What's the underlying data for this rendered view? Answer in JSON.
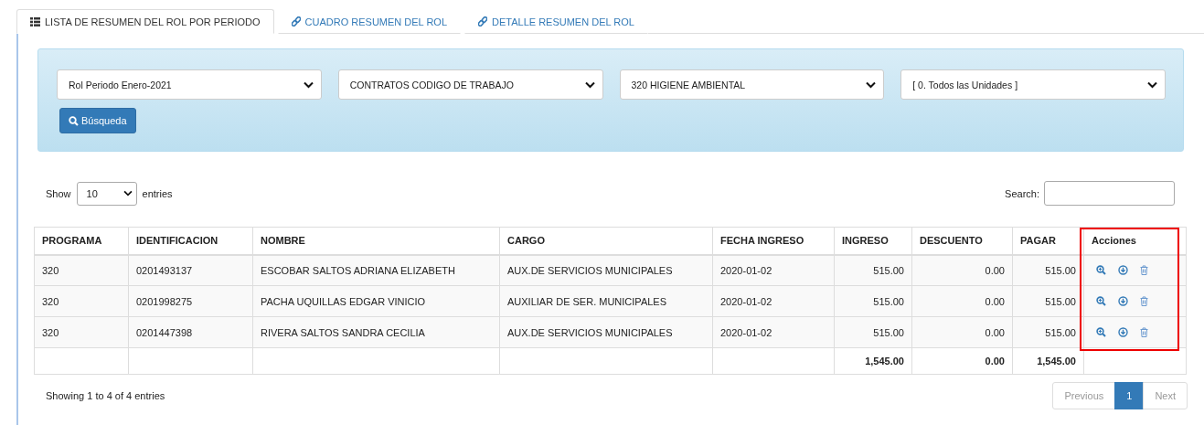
{
  "tabs": [
    {
      "label": "LISTA DE RESUMEN DEL ROL POR PERIODO",
      "selected": true
    },
    {
      "label": "CUADRO RESUMEN DEL ROL",
      "selected": false
    },
    {
      "label": "DETALLE RESUMEN DEL ROL",
      "selected": false
    }
  ],
  "filters": [
    {
      "value": "Rol Periodo Enero-2021"
    },
    {
      "value": "CONTRATOS CODIGO DE TRABAJO"
    },
    {
      "value": "320 HIGIENE AMBIENTAL"
    },
    {
      "value": "[ 0. Todos las Unidades ]"
    }
  ],
  "search_button": "Búsqueda",
  "length": {
    "before": "Show",
    "value": "10",
    "after": "entries"
  },
  "search": {
    "label": "Search:"
  },
  "table": {
    "columns": [
      {
        "label": "PROGRAMA",
        "highlighted": false
      },
      {
        "label": "IDENTIFICACION",
        "highlighted": false
      },
      {
        "label": "NOMBRE",
        "highlighted": false
      },
      {
        "label": "CARGO",
        "highlighted": false
      },
      {
        "label": "FECHA INGRESO",
        "highlighted": false
      },
      {
        "label": "INGRESO",
        "highlighted": false
      },
      {
        "label": "DESCUENTO",
        "highlighted": false
      },
      {
        "label": "PAGAR",
        "highlighted": false
      },
      {
        "label": "Acciones",
        "highlighted": true
      }
    ],
    "rows": [
      {
        "cells": [
          "320",
          "0201493137",
          "ESCOBAR SALTOS ADRIANA ELIZABETH",
          "AUX.DE SERVICIOS MUNICIPALES",
          "2020-01-02",
          "515.00",
          "0.00",
          "515.00"
        ]
      },
      {
        "cells": [
          "320",
          "0201998275",
          "PACHA UQUILLAS EDGAR VINICIO",
          "AUXILIAR DE SER. MUNICIPALES",
          "2020-01-02",
          "515.00",
          "0.00",
          "515.00"
        ]
      },
      {
        "cells": [
          "320",
          "0201447398",
          "RIVERA SALTOS SANDRA CECILIA",
          "AUX.DE SERVICIOS MUNICIPALES",
          "2020-01-02",
          "515.00",
          "0.00",
          "515.00"
        ]
      }
    ],
    "totals": {
      "ingreso": "1,545.00",
      "descuento": "0.00",
      "pagar": "1,545.00"
    }
  },
  "info": "Showing 1 to 4 of 4 entries",
  "pagination": [
    {
      "label": "Previous",
      "kind": "nav",
      "selected": false
    },
    {
      "label": "1",
      "kind": "page",
      "selected": true
    },
    {
      "label": "Next",
      "kind": "nav",
      "selected": false
    }
  ]
}
